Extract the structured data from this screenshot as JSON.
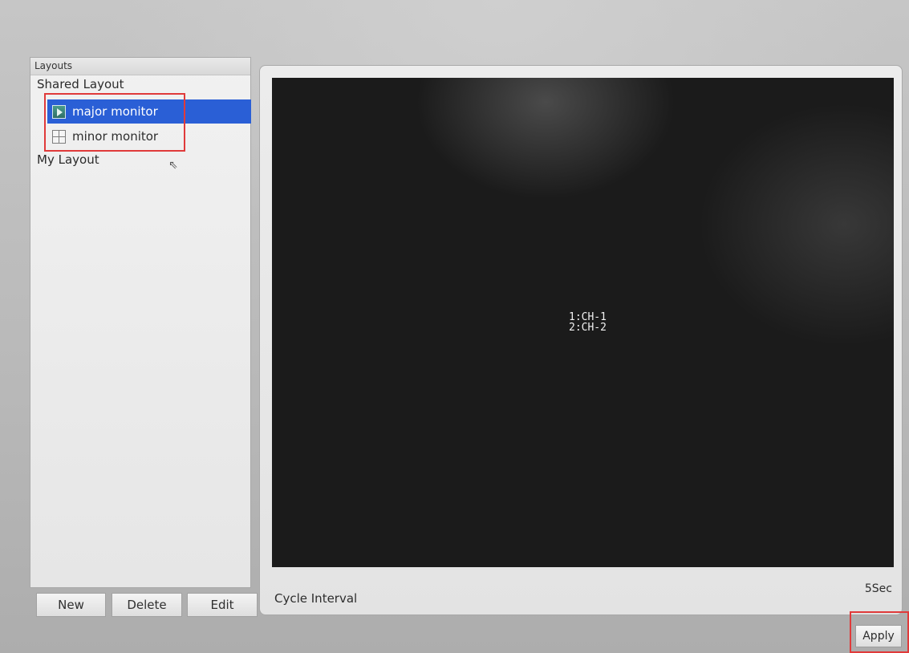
{
  "layouts_panel": {
    "title": "Layouts",
    "shared_group": "Shared Layout",
    "items": [
      {
        "label": "major monitor",
        "icon": "play-icon",
        "selected": true
      },
      {
        "label": "minor monitor",
        "icon": "grid-icon",
        "selected": false
      }
    ],
    "my_group": "My Layout"
  },
  "buttons": {
    "new": "New",
    "delete": "Delete",
    "edit": "Edit",
    "apply": "Apply"
  },
  "preview": {
    "channels": [
      "1:CH-1",
      "2:CH-2"
    ]
  },
  "cycle": {
    "label": "Cycle Interval",
    "value": "5Sec"
  },
  "colors": {
    "selection": "#2a5fd6",
    "highlight_annotation": "#e03a3a",
    "preview_background": "#1b1b1b"
  }
}
